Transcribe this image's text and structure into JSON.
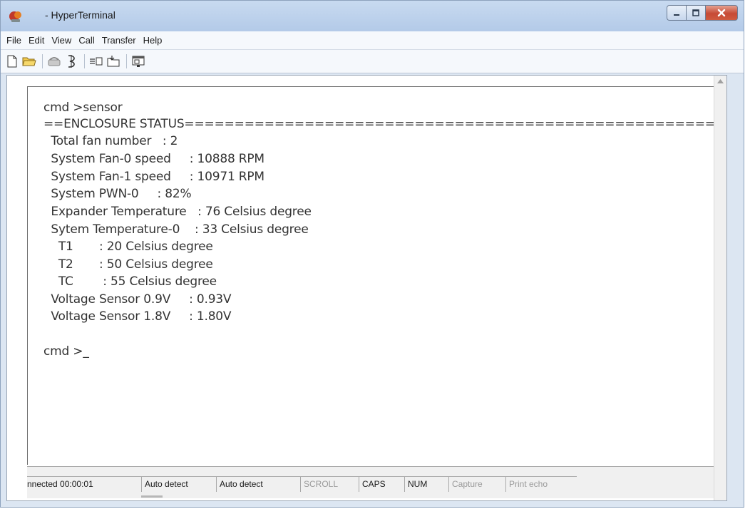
{
  "window": {
    "title": "- HyperTerminal",
    "colors": {
      "title_bar": "#b3cae8",
      "close_button": "#c64a35",
      "terminal_text": "#333333"
    }
  },
  "menu": {
    "items": [
      "File",
      "Edit",
      "View",
      "Call",
      "Transfer",
      "Help"
    ]
  },
  "toolbar": {
    "buttons": [
      "new-document-icon",
      "open-folder-icon",
      "phone-connect-icon",
      "disconnect-icon",
      "send-icon",
      "receive-icon",
      "properties-icon"
    ]
  },
  "terminal": {
    "lines": [
      "cmd >sensor",
      "==ENCLOSURE STATUS=============================================================",
      "  Total fan number   : 2",
      "  System Fan-0 speed     : 10888 RPM",
      "  System Fan-1 speed     : 10971 RPM",
      "  System PWN-0     : 82%",
      "  Expander Temperature   : 76 Celsius degree",
      "  Sytem Temperature-0    : 33 Celsius degree",
      "    T1       : 20 Celsius degree",
      "    T2       : 50 Celsius degree",
      "    TC        : 55 Celsius degree",
      "  Voltage Sensor 0.9V     : 0.93V",
      "  Voltage Sensor 1.8V     : 1.80V",
      "",
      "cmd >_"
    ]
  },
  "status_bar": {
    "connection": "nnected 00:00:01",
    "detect_1": "Auto detect",
    "detect_2": "Auto detect",
    "scroll": "SCROLL",
    "caps": "CAPS",
    "num": "NUM",
    "capture": "Capture",
    "print_echo": "Print echo"
  }
}
